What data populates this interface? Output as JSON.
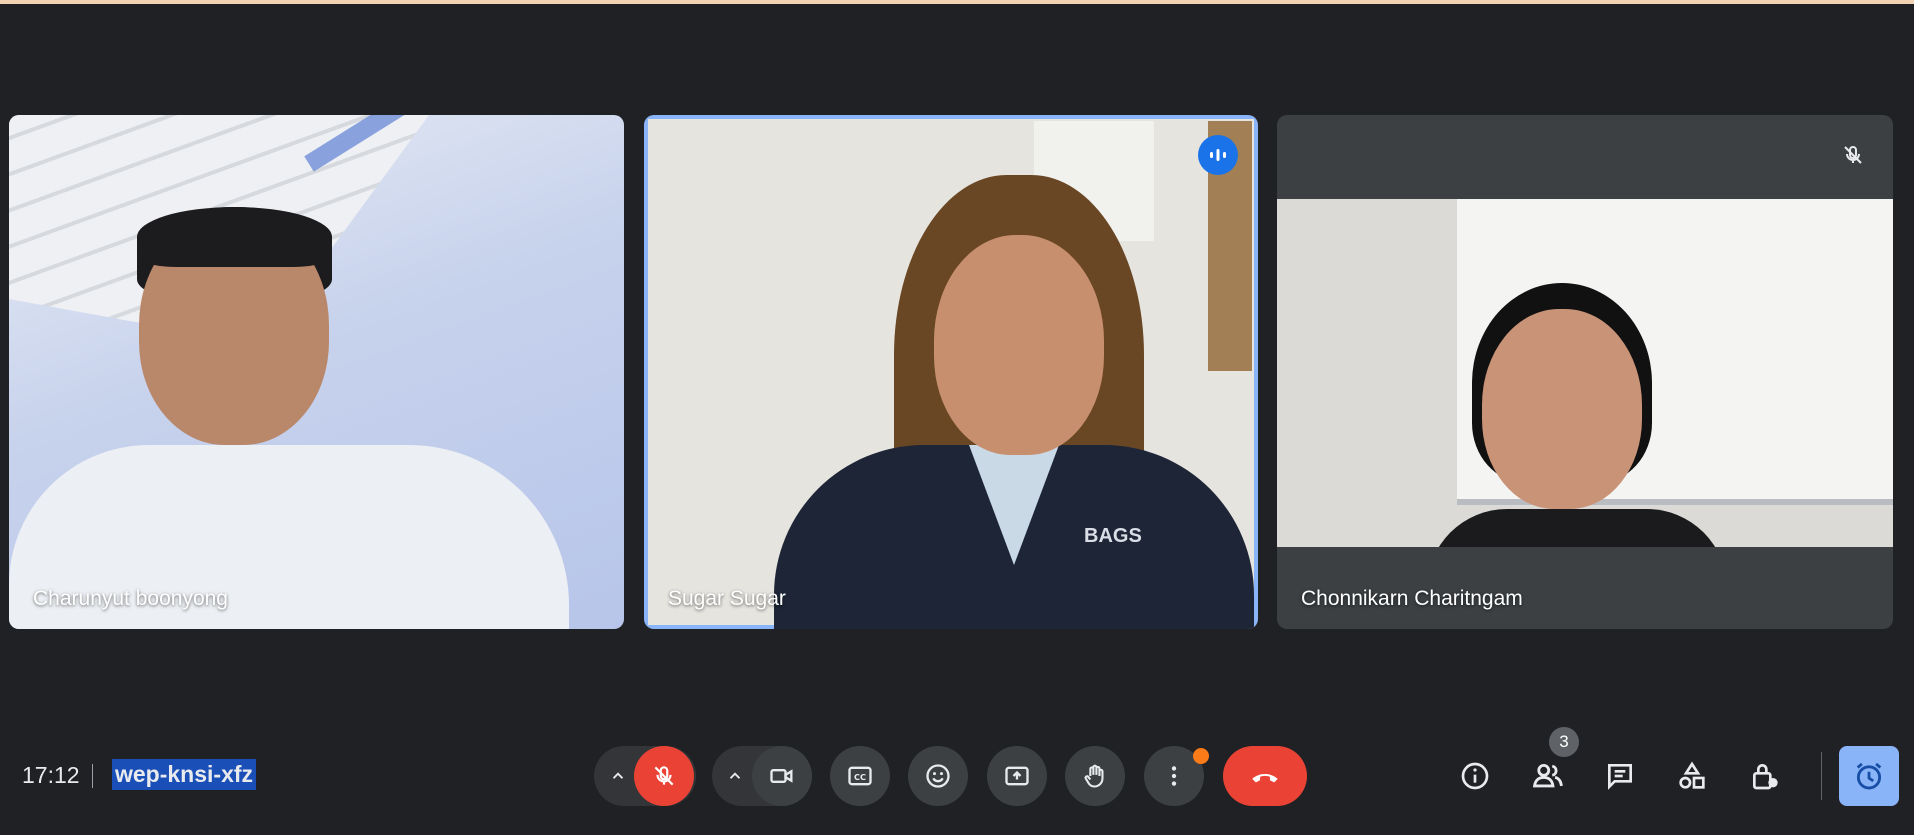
{
  "participants": [
    {
      "name": "Charunyut boonyong"
    },
    {
      "name": "Sugar Sugar",
      "shirt_logo": "BAGS"
    },
    {
      "name": "Chonnikarn Charitngam"
    }
  ],
  "meeting": {
    "time": "17:12",
    "code": "wep-knsi-xfz",
    "people_count": "3"
  },
  "controls": {
    "mic": "muted",
    "icons": [
      "mic-off-icon",
      "camera-icon",
      "captions-icon",
      "emoji-icon",
      "present-icon",
      "raise-hand-icon",
      "more-icon",
      "hang-up-icon",
      "info-icon",
      "people-icon",
      "chat-icon",
      "activities-icon",
      "host-controls-icon",
      "timer-icon"
    ]
  },
  "colors": {
    "background": "#202124",
    "accent": "#8ab4f8",
    "danger": "#ea4335",
    "notification": "#fa7b17",
    "highlight": "#1a4fb8"
  }
}
